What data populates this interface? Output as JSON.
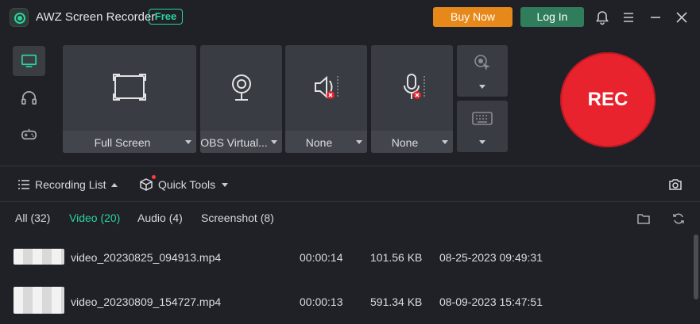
{
  "app": {
    "title": "AWZ Screen Recorder",
    "badge": "Free"
  },
  "header": {
    "buy_label": "Buy Now",
    "login_label": "Log In"
  },
  "colors": {
    "accent": "#2bd3a0",
    "buy": "#e6891a",
    "login": "#2f7d5b",
    "rec": "#e8232d"
  },
  "modes": [
    "monitor-icon",
    "headphones-icon",
    "gamepad-icon"
  ],
  "sources": {
    "screen": "Full Screen",
    "camera": "OBS Virtual...",
    "speaker": "None",
    "microphone": "None"
  },
  "rec_label": "REC",
  "toolbar": {
    "recording_list": "Recording List",
    "quick_tools": "Quick Tools"
  },
  "filters": {
    "all": "All (32)",
    "video": "Video (20)",
    "audio": "Audio (4)",
    "screenshot": "Screenshot (8)"
  },
  "recordings": [
    {
      "name": "video_20230825_094913.mp4",
      "duration": "00:00:14",
      "size": "101.56 KB",
      "date": "08-25-2023 09:49:31"
    },
    {
      "name": "video_20230809_154727.mp4",
      "duration": "00:00:13",
      "size": "591.34 KB",
      "date": "08-09-2023 15:47:51"
    }
  ]
}
